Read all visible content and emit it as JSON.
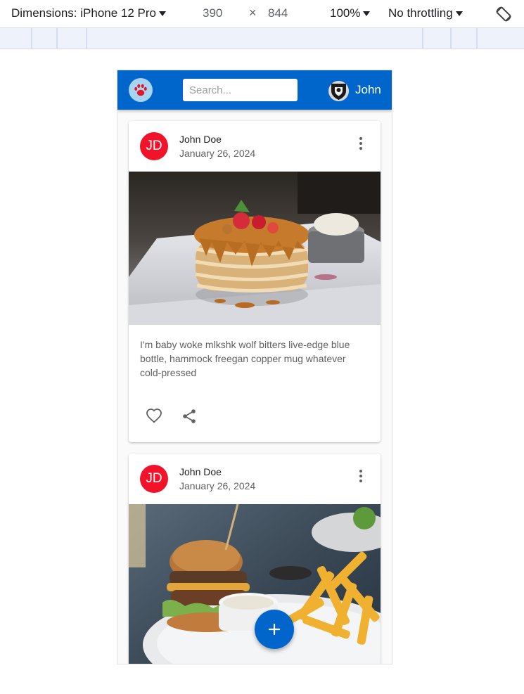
{
  "devtools": {
    "dimensions_label": "Dimensions: iPhone 12 Pro",
    "width": "390",
    "times": "×",
    "height": "844",
    "zoom": "100%",
    "throttling": "No throttling",
    "rotate_icon": "rotate-icon"
  },
  "app": {
    "logo_icon": "paw-icon",
    "search_placeholder": "Search...",
    "user_name": "John",
    "brand_color": "#0066cc"
  },
  "posts": [
    {
      "avatar_initials": "JD",
      "author": "John Doe",
      "date": "January 26, 2024",
      "image_icon": "pancakes-photo",
      "text": "I'm baby woke mlkshk wolf bitters live-edge blue bottle, hammock freegan copper mug whatever cold-pressed",
      "avatar_color": "#f0132a"
    },
    {
      "avatar_initials": "JD",
      "author": "John Doe",
      "date": "January 26, 2024",
      "image_icon": "burger-fries-photo",
      "avatar_color": "#f0132a"
    }
  ],
  "fab": {
    "icon": "plus-icon"
  }
}
